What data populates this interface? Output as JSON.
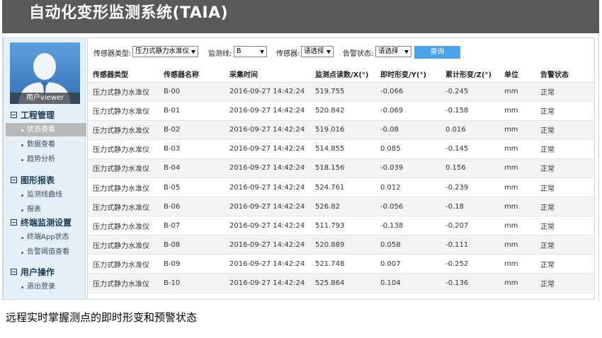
{
  "app": {
    "title": "自动化变形监测系统(TAIA)"
  },
  "user": {
    "name": "用户viewer"
  },
  "sidebar": {
    "groups": [
      {
        "label": "工程管理",
        "items": [
          "状态查看",
          "数据查看",
          "趋势分析"
        ]
      },
      {
        "label": "图形报表",
        "items": [
          "监测线曲线",
          "报表"
        ]
      },
      {
        "label": "终端监测设置",
        "items": [
          "终端App状态",
          "告警阈值查看"
        ]
      },
      {
        "label": "用户操作",
        "items": [
          "退出登录"
        ]
      }
    ],
    "active_item": "状态查看"
  },
  "filter": {
    "sensor_type_label": "传感器类型:",
    "sensor_type_value": "压力式静力水准仪",
    "line_label": "监测线:",
    "line_value": "B",
    "sensor_label": "传感器:",
    "sensor_value": "请选择",
    "alarm_label": "告警状态:",
    "alarm_value": "请选择",
    "query_label": "查询"
  },
  "table": {
    "columns": [
      "传感器类型",
      "传感器名称",
      "采集时间",
      "监测点读数/X(°)",
      "即时形变/Y(°)",
      "累计形变/Z(°)",
      "单位",
      "告警状态"
    ],
    "rows": [
      [
        "压力式静力水准仪",
        "B-00",
        "2016-09-27 14:42:24",
        "519.755",
        "-0.066",
        "-0.245",
        "mm",
        "正常"
      ],
      [
        "压力式静力水准仪",
        "B-01",
        "2016-09-27 14:42:24",
        "520.842",
        "-0.069",
        "-0.158",
        "mm",
        "正常"
      ],
      [
        "压力式静力水准仪",
        "B-02",
        "2016-09-27 14:42:24",
        "519.016",
        "-0.08",
        "0.016",
        "mm",
        "正常"
      ],
      [
        "压力式静力水准仪",
        "B-03",
        "2016-09-27 14:42:24",
        "514.855",
        "0.085",
        "-0.145",
        "mm",
        "正常"
      ],
      [
        "压力式静力水准仪",
        "B-04",
        "2016-09-27 14:42:24",
        "518.156",
        "-0.039",
        "0.156",
        "mm",
        "正常"
      ],
      [
        "压力式静力水准仪",
        "B-05",
        "2016-09-27 14:42:24",
        "524.761",
        "0.012",
        "-0.239",
        "mm",
        "正常"
      ],
      [
        "压力式静力水准仪",
        "B-06",
        "2016-09-27 14:42:24",
        "526.82",
        "-0.056",
        "-0.18",
        "mm",
        "正常"
      ],
      [
        "压力式静力水准仪",
        "B-07",
        "2016-09-27 14:42:24",
        "511.793",
        "-0.138",
        "-0.207",
        "mm",
        "正常"
      ],
      [
        "压力式静力水准仪",
        "B-08",
        "2016-09-27 14:42:24",
        "520.889",
        "0.058",
        "-0.111",
        "mm",
        "正常"
      ],
      [
        "压力式静力水准仪",
        "B-09",
        "2016-09-27 14:42:24",
        "521.748",
        "0.007",
        "-0.252",
        "mm",
        "正常"
      ],
      [
        "压力式静力水准仪",
        "B-10",
        "2016-09-27 14:42:24",
        "525.864",
        "0.104",
        "-0.136",
        "mm",
        "正常"
      ]
    ]
  },
  "caption": "远程实时掌握测点的即时形变和预警状态",
  "colors": {
    "topbar": "#595959",
    "sidebar_bg": "#e6f0f9",
    "accent": "#4aa3e8",
    "active_item": "#b8b8b8"
  },
  "icons": {
    "avatar": "user-avatar-icon",
    "group_toggle": "collapse-box-icon",
    "dropdown": "chevron-down-icon"
  }
}
